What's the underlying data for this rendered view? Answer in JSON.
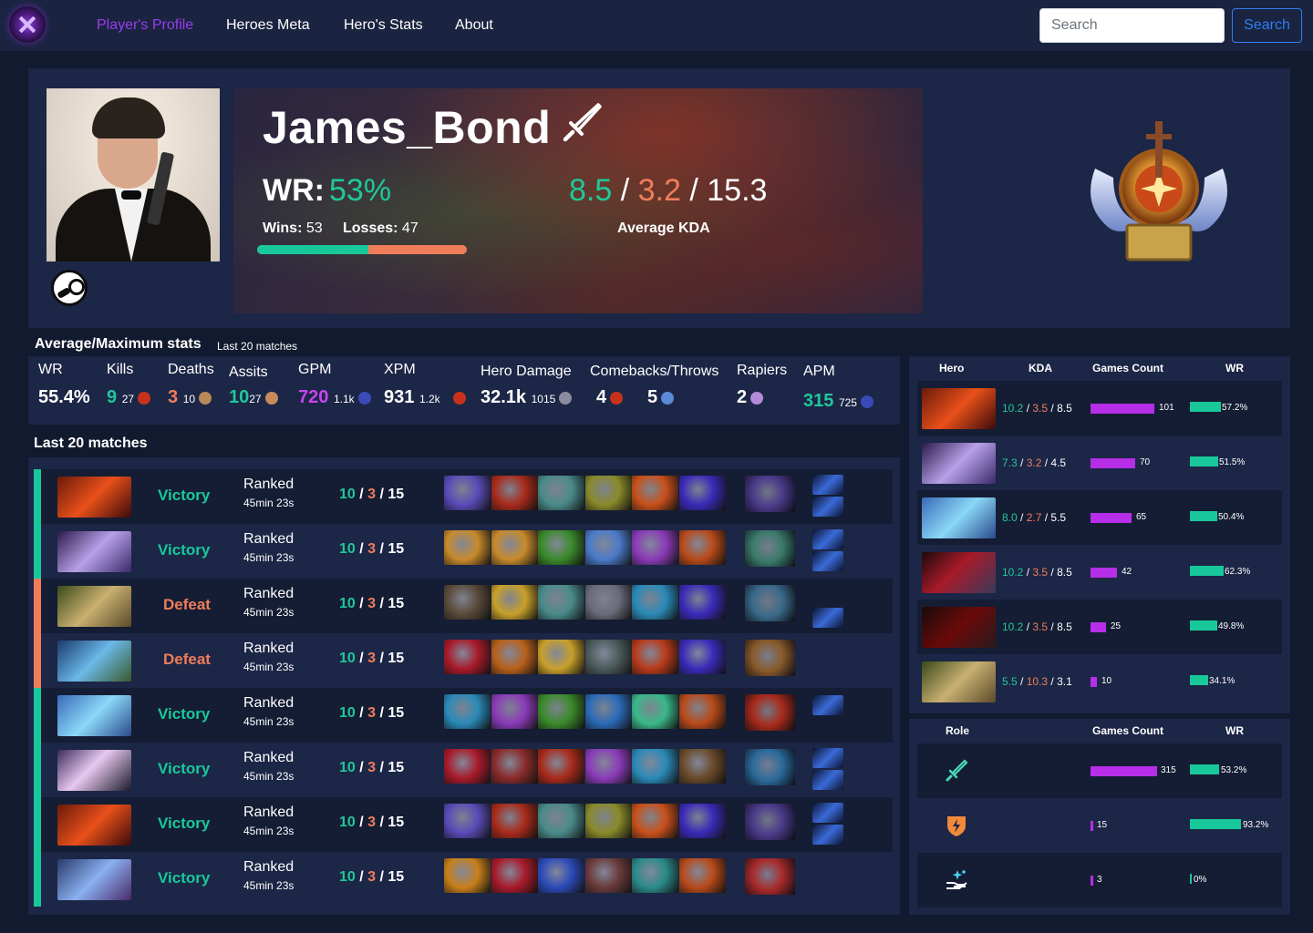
{
  "nav": {
    "links": [
      "Player's Profile",
      "Heroes Meta",
      "Hero's Stats",
      "About"
    ],
    "search_placeholder": "Search",
    "search_button": "Search"
  },
  "profile": {
    "name": "James_Bond",
    "wr_label": "WR:",
    "wr_value": "53%",
    "wins_label": "Wins:",
    "wins": "53",
    "losses_label": "Losses:",
    "losses": "47",
    "win_fraction": 0.53,
    "kda": {
      "k": "8.5",
      "d": "3.2",
      "a": "15.3",
      "sep": "/"
    },
    "kda_label": "Average KDA",
    "icons": {
      "role": "sword-icon",
      "platform": "steam-icon",
      "rank": "rank-medal-icon"
    }
  },
  "stats": {
    "title": "Average/Maximum stats",
    "subtitle": "Last 20 matches",
    "labels": [
      "WR",
      "Kills",
      "Deaths",
      "Assits",
      "GPM",
      "XPM",
      "Hero Damage",
      "Comebacks/Throws",
      "Rapiers",
      "APM"
    ],
    "wr": "55.4%",
    "kills": {
      "avg": "9",
      "max": "27"
    },
    "deaths": {
      "avg": "3",
      "max": "10"
    },
    "assists": {
      "avg": "10",
      "max": "27"
    },
    "gpm": {
      "avg": "720",
      "max": "1.1k"
    },
    "xpm": {
      "avg": "931",
      "max": "1.2k"
    },
    "hero_damage": {
      "avg": "32.1k",
      "max": "1015"
    },
    "comebacks": "4",
    "throws": "5",
    "rapiers": "2",
    "apm": {
      "avg": "315",
      "max": "725"
    }
  },
  "matches": {
    "title": "Last 20 matches",
    "rows": [
      {
        "result": "Victory",
        "mode": "Ranked",
        "duration": "45min 23s",
        "k": "10",
        "d": "3",
        "a": "15",
        "win": true
      },
      {
        "result": "Victory",
        "mode": "Ranked",
        "duration": "45min 23s",
        "k": "10",
        "d": "3",
        "a": "15",
        "win": true
      },
      {
        "result": "Defeat",
        "mode": "Ranked",
        "duration": "45min 23s",
        "k": "10",
        "d": "3",
        "a": "15",
        "win": false
      },
      {
        "result": "Defeat",
        "mode": "Ranked",
        "duration": "45min 23s",
        "k": "10",
        "d": "3",
        "a": "15",
        "win": false
      },
      {
        "result": "Victory",
        "mode": "Ranked",
        "duration": "45min 23s",
        "k": "10",
        "d": "3",
        "a": "15",
        "win": true
      },
      {
        "result": "Victory",
        "mode": "Ranked",
        "duration": "45min 23s",
        "k": "10",
        "d": "3",
        "a": "15",
        "win": true
      },
      {
        "result": "Victory",
        "mode": "Ranked",
        "duration": "45min 23s",
        "k": "10",
        "d": "3",
        "a": "15",
        "win": true
      },
      {
        "result": "Victory",
        "mode": "Ranked",
        "duration": "45min 23s",
        "k": "10",
        "d": "3",
        "a": "15",
        "win": true
      }
    ]
  },
  "heroes": {
    "headers": [
      "Hero",
      "KDA",
      "Games Count",
      "WR"
    ],
    "rows": [
      {
        "k": "10.2",
        "d": "3.5",
        "a": "8.5",
        "games": 101,
        "wr": "57.2%",
        "wr_num": 57.2
      },
      {
        "k": "7.3",
        "d": "3.2",
        "a": "4.5",
        "games": 70,
        "wr": "51.5%",
        "wr_num": 51.5
      },
      {
        "k": "8.0",
        "d": "2.7",
        "a": "5.5",
        "games": 65,
        "wr": "50.4%",
        "wr_num": 50.4
      },
      {
        "k": "10.2",
        "d": "3.5",
        "a": "8.5",
        "games": 42,
        "wr": "62.3%",
        "wr_num": 62.3
      },
      {
        "k": "10.2",
        "d": "3.5",
        "a": "8.5",
        "games": 25,
        "wr": "49.8%",
        "wr_num": 49.8
      },
      {
        "k": "5.5",
        "d": "10.3",
        "a": "3.1",
        "games": 10,
        "wr": "34.1%",
        "wr_num": 34.1
      }
    ]
  },
  "roles": {
    "headers": [
      "Role",
      "Games Count",
      "WR"
    ],
    "rows": [
      {
        "icon": "sword-role-icon",
        "games": 315,
        "wr": "53.2%",
        "wr_num": 53.2
      },
      {
        "icon": "lightning-shield-icon",
        "games": 15,
        "wr": "93.2%",
        "wr_num": 93.2
      },
      {
        "icon": "support-hand-icon",
        "games": 3,
        "wr": "0%",
        "wr_num": 0
      }
    ]
  },
  "colors": {
    "win": "#19c89a",
    "loss": "#f07d5a",
    "accent_purple": "#9b3bf0",
    "games_bar": "#b72ee8",
    "panel": "#1c2646",
    "background": "#111a2e"
  }
}
